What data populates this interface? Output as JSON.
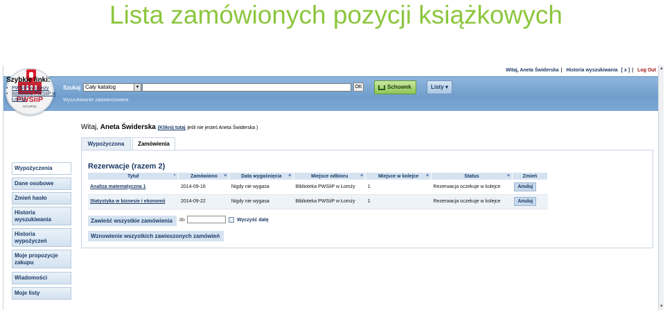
{
  "slide_title": "Lista zamówionych pozycji książkowych",
  "topbar": {
    "greeting": "Witaj, Aneta Świderska",
    "history": "Historia wyszukiwania",
    "history_count": "[ x ]",
    "logout": "Log Out"
  },
  "header": {
    "logo_text": "PWSIiP",
    "logo_sub": "w Łomży",
    "search_label": "Szukaj",
    "catalog_select": "Cały katalog",
    "search_value": "",
    "ok_label": "OK",
    "schowek_label": "Schowek",
    "listy_label": "Listy ▾",
    "advanced_link": "Wyszukiwanie zaawansowane"
  },
  "quick_links": {
    "title": "Szybkie linki:",
    "items": [
      "PWSIiP w Łomży",
      "Biblioteka PWSIiP w Łomży"
    ]
  },
  "nav": {
    "items": [
      "Wypożyczenia",
      "Dane osobowe",
      "Zmień hasło",
      "Historia wyszukiwania",
      "Historia wypożyczeń",
      "Moje propozycje zakupu",
      "Wiadomości",
      "Moje listy"
    ]
  },
  "welcome": {
    "prefix": "Witaj,",
    "name": "Aneta Świderska",
    "click_here": "(Kliknij tutaj",
    "rest": "jeśli nie jesteś Aneta Świderska )"
  },
  "tabs": [
    "Wypożyczona",
    "Zamówienia"
  ],
  "reservations": {
    "title": "Rezerwacje (razem 2)",
    "columns": [
      "Tytuł",
      "Zamówiono",
      "Data wygaśnięcia",
      "Miejsce odbioru",
      "Miejsce w kolejce",
      "Status",
      "Zmień"
    ],
    "rows": [
      {
        "title": "Analiza matematyczna 1",
        "ordered": "2014-09-16",
        "expires": "Nigdy nie wygasa",
        "pickup": "Biblioteka PWSIiP w Łomży",
        "queue": "1",
        "status": "Rezerwacja oczekuje w kolejce",
        "action": "Anuluj"
      },
      {
        "title": "Statystyka w biznesie i ekonomii",
        "ordered": "2014-09-22",
        "expires": "Nigdy nie wygasa",
        "pickup": "Biblioteka PWSIiP w Łomży",
        "queue": "1",
        "status": "Rezerwacja oczekuje w kolejce",
        "action": "Anuluj"
      }
    ],
    "suspend_label": "Zawieść wszystkie zamówienia",
    "do_label": "do",
    "date_value": "",
    "clear_date_label": "Wyczyść datę",
    "resume_label": "Wznowienie wszystkich zawieszonych zamówień"
  }
}
